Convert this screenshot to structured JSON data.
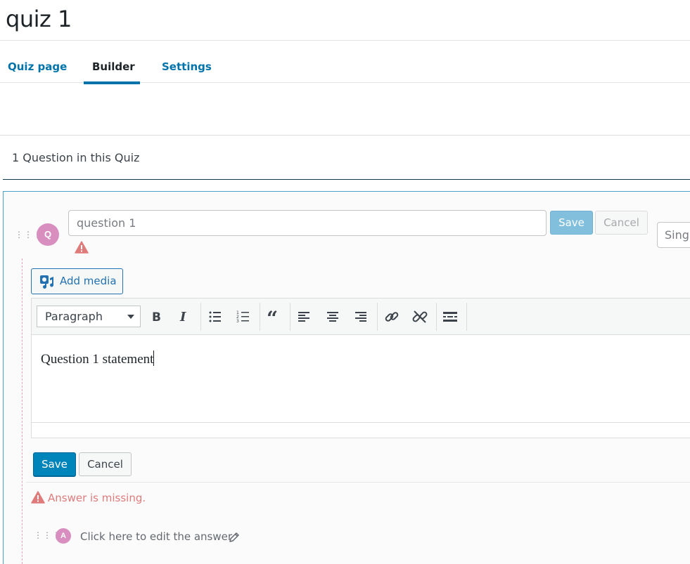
{
  "page": {
    "title": "quiz 1"
  },
  "tabs": [
    {
      "label": "Quiz page",
      "active": false
    },
    {
      "label": "Builder",
      "active": true
    },
    {
      "label": "Settings",
      "active": false
    }
  ],
  "builder": {
    "question_count": "1 Question in this Quiz"
  },
  "question": {
    "badge": "Q",
    "title_value": "question 1",
    "save_label": "Save",
    "cancel_label": "Cancel",
    "type_select": "Singl",
    "add_media_label": "Add media",
    "editor": {
      "format_value": "Paragraph",
      "content": "Question 1 statement",
      "toolbar_icons": [
        "bold-icon",
        "italic-icon",
        "bullet-list-icon",
        "numbered-list-icon",
        "blockquote-icon",
        "align-left-icon",
        "align-center-icon",
        "align-right-icon",
        "link-icon",
        "unlink-icon",
        "read-more-icon"
      ]
    },
    "editor_save_label": "Save",
    "editor_cancel_label": "Cancel"
  },
  "answer": {
    "missing_warning": "Answer is missing.",
    "badge": "A",
    "edit_prompt": "Click here to edit the answer"
  },
  "colors": {
    "accent": "#0073aa",
    "badge": "#d88fc0",
    "warning": "#e07b7b"
  }
}
